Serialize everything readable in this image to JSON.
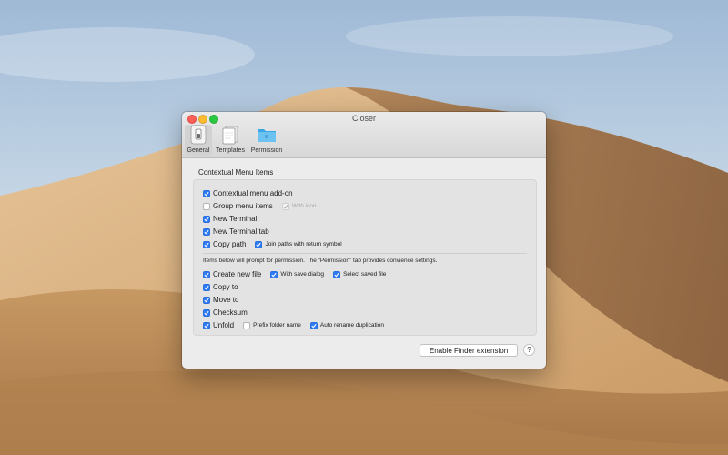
{
  "window": {
    "title": "Closer",
    "buttons": {
      "close": "close",
      "minimize": "minimize",
      "zoom": "zoom"
    }
  },
  "toolbar": {
    "items": [
      {
        "label": "General",
        "icon": "switch-icon",
        "selected": true
      },
      {
        "label": "Templates",
        "icon": "documents-icon",
        "selected": false
      },
      {
        "label": "Permission",
        "icon": "folder-icon",
        "selected": false
      }
    ]
  },
  "section": {
    "title": "Contextual Menu Items",
    "options": [
      {
        "label": "Contextual menu add-on",
        "checked": true
      },
      {
        "label": "Group menu items",
        "checked": false,
        "sub": [
          {
            "label": "With icon",
            "checked": true,
            "disabled": true
          }
        ]
      },
      {
        "label": "New Terminal",
        "checked": true
      },
      {
        "label": "New Terminal tab",
        "checked": true
      },
      {
        "label": "Copy path",
        "checked": true,
        "sub": [
          {
            "label": "Join paths with return symbol",
            "checked": true
          }
        ]
      }
    ],
    "info": "Items below will prompt for permission. The “Permission” tab provides convience settings.",
    "permission_options": [
      {
        "label": "Create new file",
        "checked": true,
        "sub": [
          {
            "label": "With save dialog",
            "checked": true
          },
          {
            "label": "Select saved file",
            "checked": true
          }
        ]
      },
      {
        "label": "Copy to",
        "checked": true
      },
      {
        "label": "Move to",
        "checked": true
      },
      {
        "label": "Checksum",
        "checked": true
      },
      {
        "label": "Unfold",
        "checked": true,
        "sub": [
          {
            "label": "Prefix folder name",
            "checked": false
          },
          {
            "label": "Auto rename duplication",
            "checked": true
          }
        ]
      }
    ]
  },
  "footer": {
    "enable_button": "Enable Finder extension",
    "help_button": "?"
  },
  "colors": {
    "accent": "#2f7bf5",
    "close": "#fc5f57",
    "minimize": "#fdbc2e",
    "zoom": "#28c840"
  }
}
